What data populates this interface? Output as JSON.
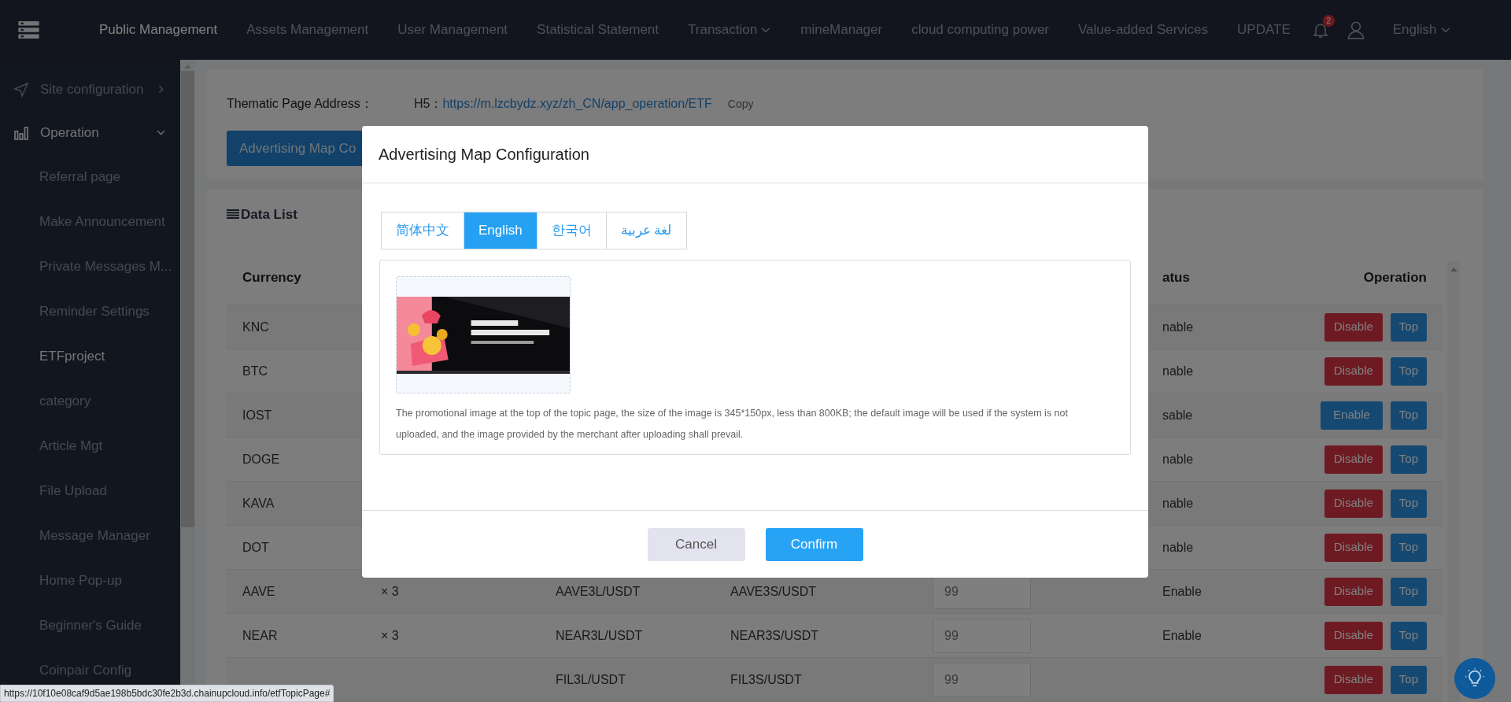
{
  "nav": {
    "items": [
      {
        "label": "Public Management",
        "selected": true,
        "dropdown": false
      },
      {
        "label": "Assets Management",
        "selected": false,
        "dropdown": false
      },
      {
        "label": "User Management",
        "selected": false,
        "dropdown": false
      },
      {
        "label": "Statistical Statement",
        "selected": false,
        "dropdown": false
      },
      {
        "label": "Transaction",
        "selected": false,
        "dropdown": true
      },
      {
        "label": "mineManager",
        "selected": false,
        "dropdown": false
      },
      {
        "label": "cloud computing power",
        "selected": false,
        "dropdown": false
      },
      {
        "label": "Value-added Services",
        "selected": false,
        "dropdown": false
      },
      {
        "label": "UPDATE",
        "selected": false,
        "dropdown": false
      }
    ],
    "notification_badge": "2",
    "language": "English"
  },
  "sidebar": {
    "groups": [
      {
        "label": "Site configuration",
        "kind": "send",
        "expanded": false
      },
      {
        "label": "Operation",
        "kind": "chart",
        "expanded": true,
        "children": [
          {
            "label": "Referral page",
            "selected": false
          },
          {
            "label": "Make Announcement",
            "selected": false
          },
          {
            "label": "Private Messages M...",
            "selected": false
          },
          {
            "label": "Reminder Settings",
            "selected": false
          },
          {
            "label": "ETFproject",
            "selected": true
          },
          {
            "label": "category",
            "selected": false
          },
          {
            "label": "Article Mgt",
            "selected": false
          },
          {
            "label": "File Upload",
            "selected": false
          },
          {
            "label": "Message Manager",
            "selected": false
          },
          {
            "label": "Home Pop-up",
            "selected": false
          },
          {
            "label": "Beginner's Guide",
            "selected": false
          },
          {
            "label": "Coinpair Config",
            "selected": false
          }
        ]
      }
    ]
  },
  "address_card": {
    "label": "Thematic Page Address：",
    "prefix": "H5：",
    "link": "https://m.lzcbydz.xyz/zh_CN/app_operation/ETF",
    "copy": "Copy",
    "button": "Advertising Map Co"
  },
  "data_list": {
    "title": "Data List",
    "columns": [
      "Currency",
      "atus",
      "Operation"
    ],
    "rows": [
      {
        "currency": "KNC",
        "status": "nable",
        "action": {
          "label": "Disable",
          "kind": "danger"
        },
        "top": "Top"
      },
      {
        "currency": "BTC",
        "status": "nable",
        "action": {
          "label": "Disable",
          "kind": "danger"
        },
        "top": "Top"
      },
      {
        "currency": "IOST",
        "status": "sable",
        "action": {
          "label": "Enable",
          "kind": "primary"
        },
        "top": "Top"
      },
      {
        "currency": "DOGE",
        "status": "nable",
        "action": {
          "label": "Disable",
          "kind": "danger"
        },
        "top": "Top"
      },
      {
        "currency": "KAVA",
        "status": "nable",
        "action": {
          "label": "Disable",
          "kind": "danger"
        },
        "top": "Top"
      },
      {
        "currency": "DOT",
        "status": "nable",
        "action": {
          "label": "Disable",
          "kind": "danger"
        },
        "top": "Top"
      },
      {
        "currency": "AAVE",
        "multiple": "× 3",
        "long_pair": "AAVE3L/USDT",
        "short_pair": "AAVE3S/USDT",
        "value": "99",
        "status": "Enable",
        "action": {
          "label": "Disable",
          "kind": "danger"
        },
        "top": "Top"
      },
      {
        "currency": "NEAR",
        "multiple": "× 3",
        "long_pair": "NEAR3L/USDT",
        "short_pair": "NEAR3S/USDT",
        "value": "99",
        "status": "Enable",
        "action": {
          "label": "Disable",
          "kind": "danger"
        },
        "top": "Top"
      },
      {
        "long_pair": "FIL3L/USDT",
        "short_pair": "FIL3S/USDT",
        "value": "99",
        "action": {
          "label": "Disable",
          "kind": "danger"
        },
        "top": "Top"
      }
    ]
  },
  "modal": {
    "title": "Advertising Map Configuration",
    "tabs": [
      {
        "label": "简体中文",
        "selected": false
      },
      {
        "label": "English",
        "selected": true
      },
      {
        "label": "한국어",
        "selected": false
      },
      {
        "label": "لغة عربية",
        "selected": false
      }
    ],
    "hint": "The promotional image at the top of the topic page, the size of the image is 345*150px, less than 800KB; the default image will be used if the system is not uploaded, and the image provided by the merchant after uploading shall prevail.",
    "cancel": "Cancel",
    "confirm": "Confirm"
  },
  "status_url": "https://10f10e08caf9d5ae198b5bdc30fe2b3d.chainupcloud.info/etfTopicPage#"
}
